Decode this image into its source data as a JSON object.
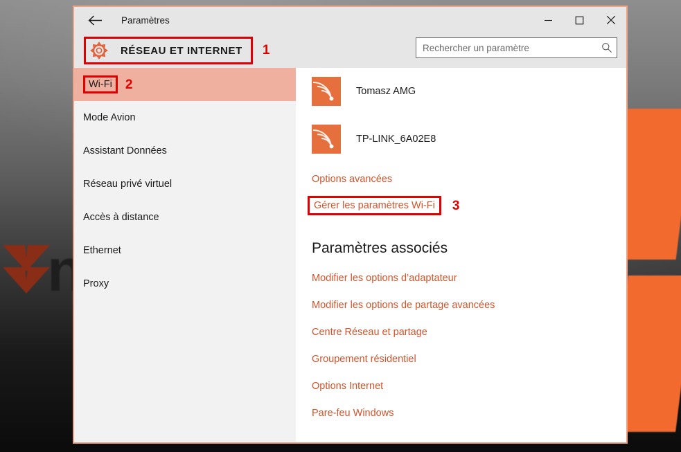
{
  "window": {
    "title": "Paramètres",
    "back_icon": "back-arrow-icon",
    "minimize_label": "–",
    "maximize_label": "□",
    "close_label": "✕"
  },
  "header": {
    "gear_icon": "gear-icon",
    "category": "RÉSEAU ET INTERNET"
  },
  "search": {
    "placeholder": "Rechercher un paramètre",
    "value": "",
    "icon": "search-icon"
  },
  "sidebar": {
    "items": [
      {
        "label": "Wi-Fi",
        "selected": true
      },
      {
        "label": "Mode Avion",
        "selected": false
      },
      {
        "label": "Assistant Données",
        "selected": false
      },
      {
        "label": "Réseau privé virtuel",
        "selected": false
      },
      {
        "label": "Accès à distance",
        "selected": false
      },
      {
        "label": "Ethernet",
        "selected": false
      },
      {
        "label": "Proxy",
        "selected": false
      }
    ]
  },
  "content": {
    "networks": [
      {
        "name": "Tomasz AMG",
        "icon": "wifi-signal-icon"
      },
      {
        "name": "TP-LINK_6A02E8",
        "icon": "wifi-signal-icon"
      }
    ],
    "links": [
      {
        "label": "Options avancées",
        "boxed": false
      },
      {
        "label": "Gérer les paramètres Wi-Fi",
        "boxed": true
      }
    ],
    "related_title": "Paramètres associés",
    "related_links": [
      "Modifier les options d’adaptateur",
      "Modifier les options de partage avancées",
      "Centre Réseau et partage",
      "Groupement résidentiel",
      "Options Internet",
      "Pare-feu Windows"
    ]
  },
  "annotations": [
    {
      "number": "1",
      "target": "category-header"
    },
    {
      "number": "2",
      "target": "sidebar-item-wifi"
    },
    {
      "number": "3",
      "target": "manage-wifi-settings-link"
    }
  ],
  "colors": {
    "accent_orange": "#e6703d",
    "link_orange": "#d4532a",
    "selected_row": "#efb0a0",
    "annotation_red": "#e00000",
    "window_border": "#e9a48a",
    "chrome_gray": "#e6e6e6",
    "sidebar_gray": "#f2f2f2"
  }
}
